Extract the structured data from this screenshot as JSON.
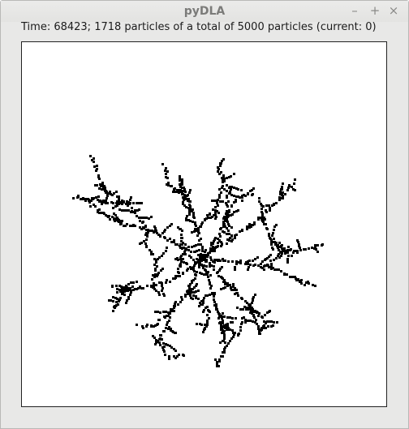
{
  "window": {
    "title": "pyDLA",
    "controls": {
      "minimize": "–",
      "maximize": "+",
      "close": "×"
    }
  },
  "status": {
    "text": "Time: 68423; 1718 particles of a total of 5000 particles (current: 0)"
  },
  "colors": {
    "chrome": "#e8e8e7",
    "canvas": "#ffffff",
    "particle": "#000000"
  }
}
